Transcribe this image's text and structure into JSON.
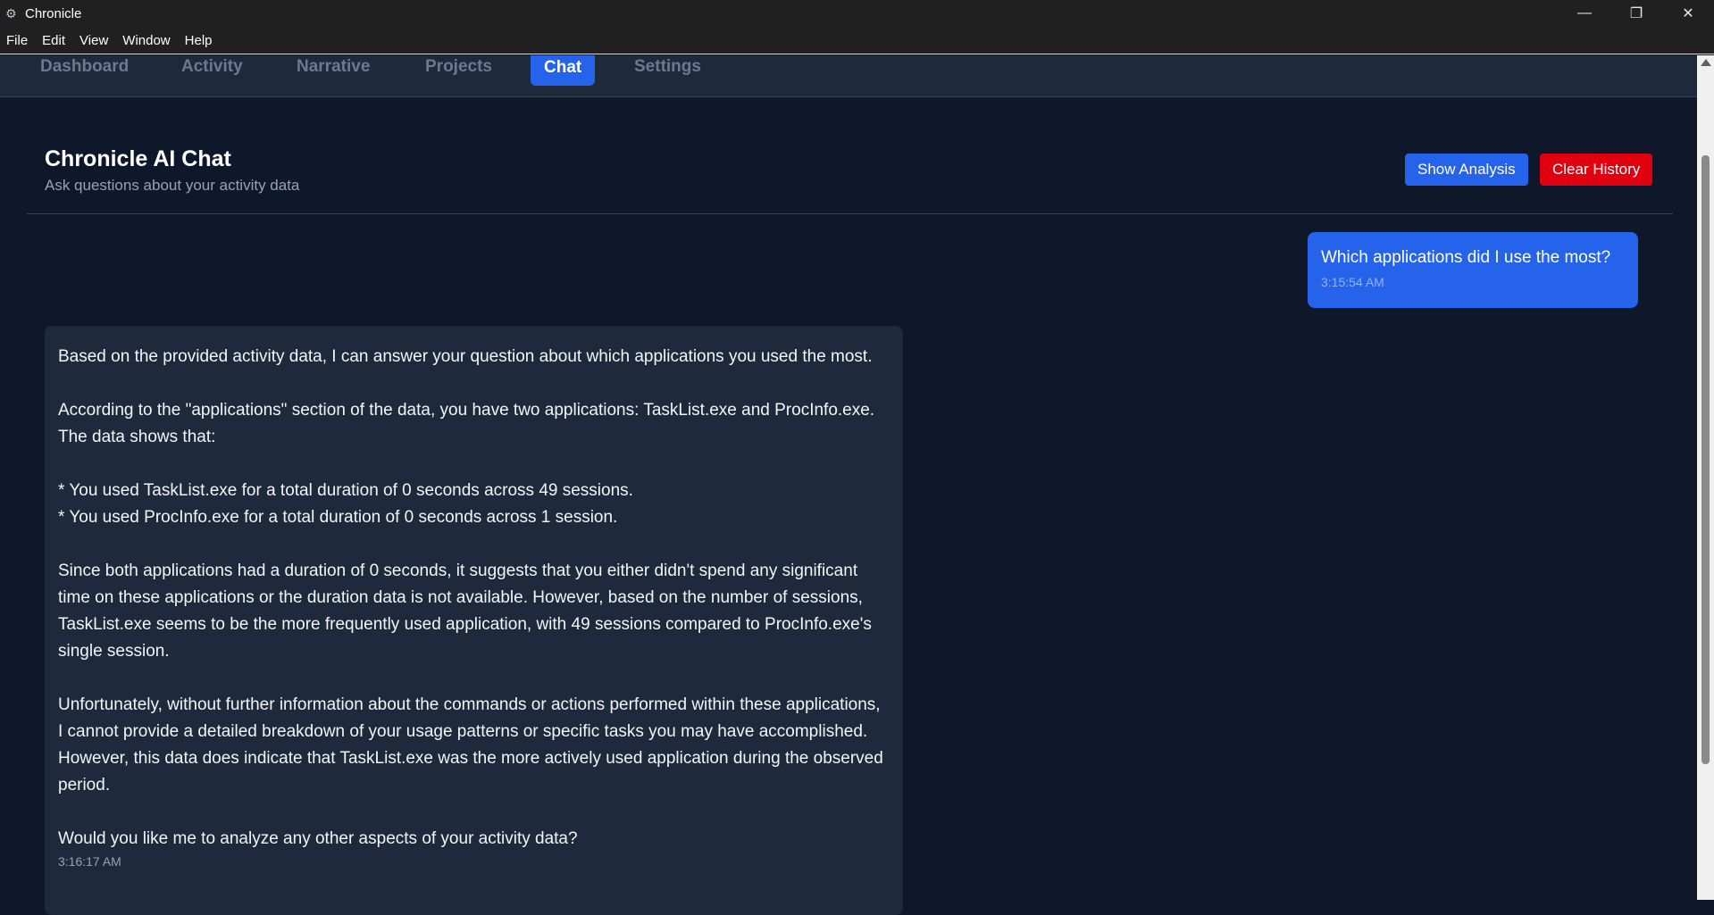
{
  "window": {
    "title": "Chronicle",
    "controls": [
      "minimize-icon",
      "restore-icon",
      "close-icon"
    ]
  },
  "menu": {
    "items": [
      "File",
      "Edit",
      "View",
      "Window",
      "Help"
    ]
  },
  "nav": {
    "tabs": [
      "Dashboard",
      "Activity",
      "Narrative",
      "Projects",
      "Chat",
      "Settings"
    ],
    "active": "Chat"
  },
  "header": {
    "title": "Chronicle AI Chat",
    "subtitle": "Ask questions about your activity data",
    "show_analysis_label": "Show Analysis",
    "clear_history_label": "Clear History"
  },
  "messages": {
    "user": {
      "text": "Which applications did I use the most?",
      "time": "3:15:54 AM"
    },
    "assistant": {
      "paragraphs": [
        "Based on the provided activity data, I can answer your question about which applications you used the most.",
        "According to the \"applications\" section of the data, you have two applications: TaskList.exe and ProcInfo.exe. The data shows that:",
        "* You used TaskList.exe for a total duration of 0 seconds across 49 sessions.",
        "* You used ProcInfo.exe for a total duration of 0 seconds across 1 session.",
        "Since both applications had a duration of 0 seconds, it suggests that you either didn't spend any significant time on these applications or the duration data is not available. However, based on the number of sessions, TaskList.exe seems to be the more frequently used application, with 49 sessions compared to ProcInfo.exe's single session.",
        "Unfortunately, without further information about the commands or actions performed within these applications, I cannot provide a detailed breakdown of your usage patterns or specific tasks you may have accomplished. However, this data does indicate that TaskList.exe was the more actively used application during the observed period.",
        "Would you like me to analyze any other aspects of your activity data?"
      ],
      "time": "3:16:17 AM"
    }
  },
  "colors": {
    "accent": "#2563eb",
    "danger": "#e0000f",
    "background": "#0f172a",
    "surface": "#1e293b"
  }
}
